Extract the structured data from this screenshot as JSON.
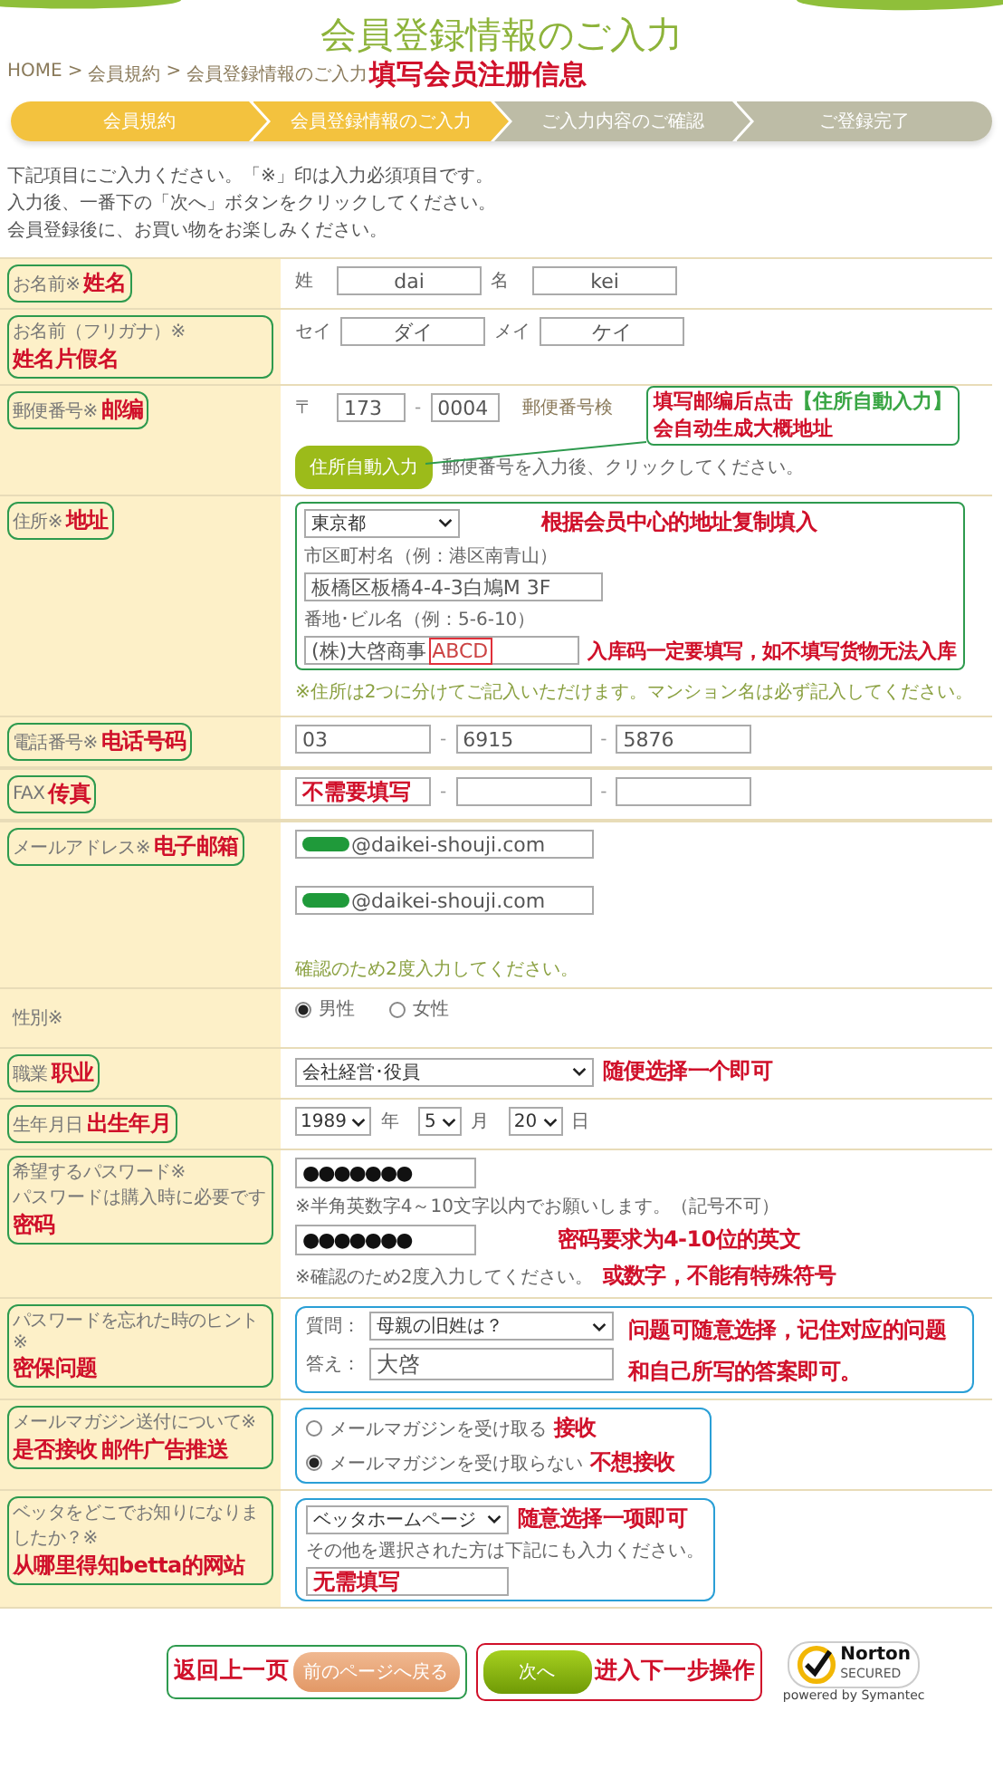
{
  "page_title": "会員登録情報のご入力",
  "title_note": "填写会员注册信息",
  "breadcrumb": {
    "separator": ">",
    "items": [
      "HOME",
      "会員規約",
      "会員登録情報のご入力"
    ]
  },
  "steps": [
    {
      "label": "会員規約",
      "active": true
    },
    {
      "label": "会員登録情報のご入力",
      "active": true
    },
    {
      "label": "ご入力内容のご確認",
      "active": false
    },
    {
      "label": "ご登録完了",
      "active": false
    }
  ],
  "intro": [
    "下記項目にご入力ください。「※」印は入力必須項目です。",
    "入力後、一番下の「次へ」ボタンをクリックしてください。",
    "会員登録後に、お買い物をお楽しみください。"
  ],
  "rows": [
    {
      "kind": "pair",
      "label": "お名前※",
      "note": "姓名",
      "fields": [
        {
          "prefix": "姓",
          "value": "dai"
        },
        {
          "prefix": "名",
          "value": "kei"
        }
      ]
    },
    {
      "kind": "pair",
      "label": "お名前（フリガナ）※",
      "note": "姓名片假名",
      "fields": [
        {
          "prefix": "セイ",
          "value": "ダイ"
        },
        {
          "prefix": "メイ",
          "value": "ケイ"
        }
      ]
    },
    {
      "kind": "postal",
      "label": "郵便番号※",
      "note": "邮编",
      "prefix": "〒",
      "separator": "-",
      "parts": [
        "173",
        "0004"
      ],
      "search_link": "郵便番号検",
      "button": "住所自動入力",
      "hint": "郵便番号を入力後、クリックしてください。",
      "callout": [
        {
          "text": "填写邮编后点击",
          "highlight": "【住所自動入力】"
        },
        {
          "text": "会自动生成大概地址"
        }
      ]
    },
    {
      "kind": "address",
      "label": "住所※",
      "note": "地址",
      "prefecture": "東京都",
      "city_label": "市区町村名（例：港区南青山）",
      "city_value": "板橋区板橋4-4-3白鳩M 3F",
      "street_label": "番地･ビル名（例：5-6-10）",
      "street_value": "(株)大啓商事",
      "street_code": "ABCD",
      "annotations": [
        "根据会员中心的地址复制填入",
        "入库码一定要填写，如不填写货物无法入库"
      ],
      "footnote": "※住所は2つに分けてご記入いただけます。マンション名は必ず記入してください。"
    },
    {
      "kind": "phone",
      "label": "電話番号※",
      "note": "电话号码",
      "separator": "-",
      "parts": [
        {
          "kind": "value",
          "text": "03"
        },
        {
          "kind": "value",
          "text": "6915"
        },
        {
          "kind": "value",
          "text": "5876"
        }
      ]
    },
    {
      "kind": "phone",
      "label": "FAX",
      "note": "传真",
      "separator": "-",
      "parts": [
        {
          "kind": "note",
          "text": "不需要填写"
        },
        {
          "kind": "empty"
        },
        {
          "kind": "empty"
        }
      ]
    },
    {
      "kind": "email",
      "label": "メールアドレス※",
      "note": "电子邮箱",
      "values": [
        "@daikei-shouji.com",
        "@daikei-shouji.com"
      ],
      "hint": "確認のため2度入力してください。"
    },
    {
      "kind": "radio",
      "label": "性別※",
      "options": [
        {
          "label": "男性",
          "selected": true
        },
        {
          "label": "女性",
          "selected": false
        }
      ]
    },
    {
      "kind": "select",
      "label": "職業",
      "note": "职业",
      "value": "会社経営･役員",
      "annotation": "随便选择一个即可"
    },
    {
      "kind": "date",
      "label": "生年月日",
      "note": "出生年月",
      "parts": [
        {
          "value": "1989",
          "unit": "年"
        },
        {
          "value": "5",
          "unit": "月"
        },
        {
          "value": "20",
          "unit": "日"
        }
      ]
    },
    {
      "kind": "password",
      "label": "希望するパスワード※",
      "note": "密码",
      "sublabel": "パスワードは購入時に必要です",
      "value": "●●●●●●●",
      "confirm_value": "●●●●●●●",
      "hint": "※半角英数字4～10文字以内でお願いします。（記号不可）",
      "confirm_hint": "※確認のため2度入力してください。",
      "annotations": [
        "密码要求为4-10位的英文",
        "或数字，不能有特殊符号"
      ]
    },
    {
      "kind": "question",
      "label": "パスワードを忘れた時のヒント※",
      "note": "密保问题",
      "question_label": "質問：",
      "question": "母親の旧姓は？",
      "answer_label": "答え：",
      "answer": "大啓",
      "annotations": [
        "问题可随意选择，记住对应的问题",
        "和自己所写的答案即可。"
      ]
    },
    {
      "kind": "radio_list",
      "label": "メールマガジン送付について※",
      "note": "是否接收",
      "note2": "邮件广告推送",
      "options": [
        {
          "label": "メールマガジンを受け取る",
          "note": "接收",
          "selected": false
        },
        {
          "label": "メールマガジンを受け取らない",
          "note": "不想接收",
          "selected": true
        }
      ]
    },
    {
      "kind": "source",
      "label": "ベッタをどこでお知りになりましたか？※",
      "note": "从哪里得知betta的网站",
      "value": "ベッタホームページ",
      "annotation": "随意选择一项即可",
      "hint": "その他を選択された方は下記にも入力ください。",
      "other_note": "无需填写"
    }
  ],
  "footer": {
    "back_note": "返回上一页",
    "back": "前のページへ戻る",
    "next": "次へ",
    "next_note": "进入下一步操作",
    "badge": {
      "name": "Norton",
      "sub": "SECURED",
      "powered": "powered by Symantec"
    }
  }
}
